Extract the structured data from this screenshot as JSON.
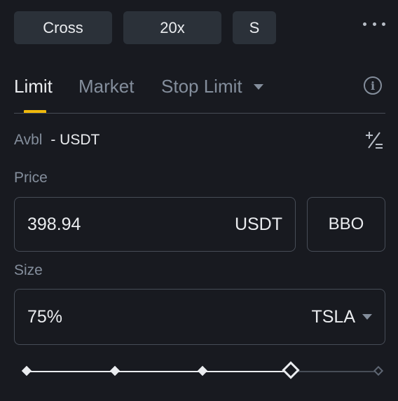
{
  "top_bar": {
    "margin_mode": "Cross",
    "leverage": "20x",
    "mode_short": "S",
    "more_icon": "more-horizontal-icon"
  },
  "tabs": [
    {
      "label": "Limit",
      "active": true
    },
    {
      "label": "Market",
      "active": false
    },
    {
      "label": "Stop Limit",
      "active": false,
      "has_dropdown": true
    }
  ],
  "info_icon": "info-icon",
  "avbl": {
    "label": "Avbl",
    "value": "- USDT",
    "calc_icon": "calculator-icon"
  },
  "price": {
    "label": "Price",
    "value": "398.94",
    "unit": "USDT",
    "bbo_label": "BBO"
  },
  "size": {
    "label": "Size",
    "value": "75%",
    "symbol": "TSLA"
  },
  "slider": {
    "value_fraction": 0.75,
    "stops": [
      0,
      0.25,
      0.5,
      0.75,
      1
    ]
  },
  "colors": {
    "background": "#181a20",
    "accent": "#f0b90b",
    "button_bg": "#2b3139",
    "muted_text": "#848e9c",
    "border": "#474d57"
  }
}
